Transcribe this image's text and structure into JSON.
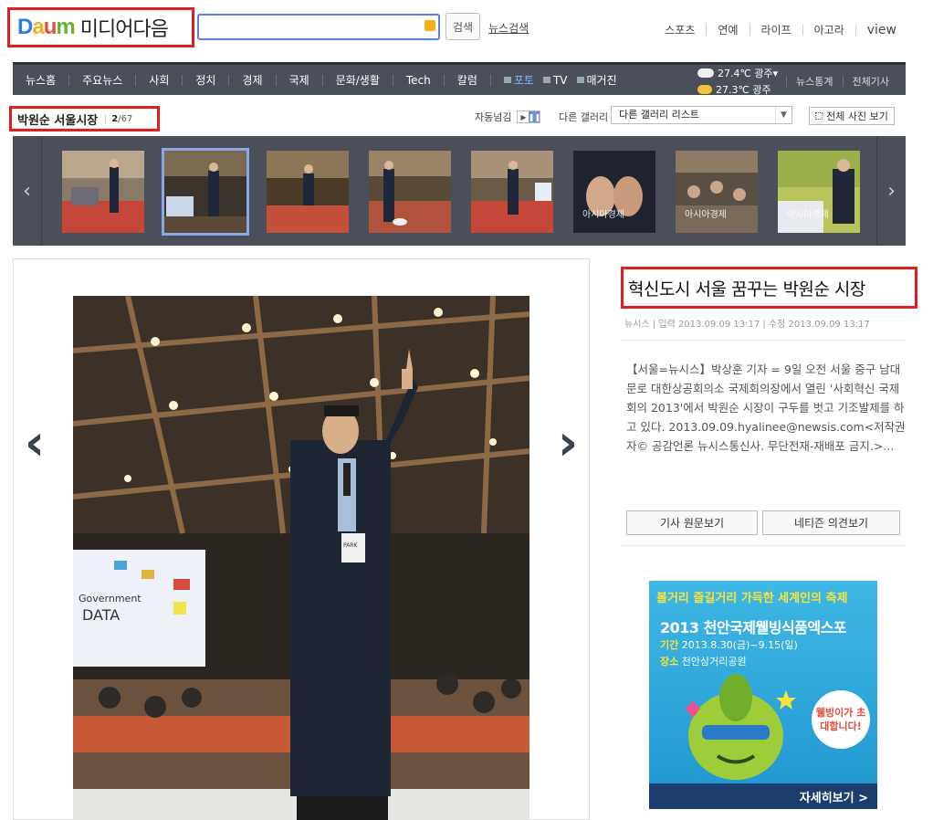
{
  "header": {
    "logo_brand": "Daum",
    "logo_text": "미디어다음",
    "search_placeholder": "",
    "search_button": "검색",
    "news_search": "뉴스검색",
    "top_links": [
      "스포츠",
      "연예",
      "라이프",
      "아고라",
      "view"
    ]
  },
  "nav": {
    "items": [
      "뉴스홈",
      "주요뉴스",
      "사회",
      "정치",
      "경제",
      "국제",
      "문화/생활",
      "Tech",
      "칼럼"
    ],
    "media_items": [
      "포토",
      "TV",
      "매거진"
    ],
    "weather": [
      {
        "temp": "27.4℃",
        "city": "광주"
      },
      {
        "temp": "27.3℃",
        "city": "광주"
      }
    ],
    "right": [
      "뉴스통계",
      "전체기사"
    ]
  },
  "gallery": {
    "title": "박원순 서울시장",
    "current": "2",
    "total": "/67",
    "auto_slide_label": "자동넘김",
    "other_gallery_label": "다른 갤러리",
    "select_value": "다른 갤러리 리스트",
    "all_photos": "전체 사진 보기",
    "watermark": "아시아경제",
    "thumbnails": 8
  },
  "article": {
    "title": "혁신도시 서울 꿈꾸는 박원순 시장",
    "source": "뉴시스",
    "input_time": "입력 2013.09.09 13:17",
    "edit_time": "수정 2013.09.09 13:17",
    "body": "【서울=뉴시스】박상훈 기자 = 9일 오전 서울 중구 남대문로 대한상공회의소 국제회의장에서 열린 '사회혁신 국제회의 2013'에서 박원순 시장이 구두를 벗고 기조발제를 하고 있다. 2013.09.09.hyalinee@newsis.com<저작권자© 공감언론 뉴시스통신사. 무단전재-재배포 금지.>...",
    "btn_original": "기사 원문보기",
    "btn_comments": "네티즌 의견보기"
  },
  "photo": {
    "screen_text_1": "Government",
    "screen_text_2": "DATA",
    "badge": "PARK"
  },
  "ad": {
    "line1": "볼거리 즐길거리 가득한 세계인의 축제",
    "line2": "2013 천안국제웰빙식품엑스포",
    "period_label": "기간",
    "period": "2013.8.30(금)~9.15(일)",
    "place_label": "장소",
    "place": "천안삼거리공원",
    "bubble": "웰빙이가 초대합니다!",
    "more": "자세히보기 >"
  },
  "colors": {
    "highlight_border": "#e02020",
    "nav_bg": "#4a4f59",
    "search_border": "#5b7fe0",
    "ad_bg": "#1f95d0"
  }
}
